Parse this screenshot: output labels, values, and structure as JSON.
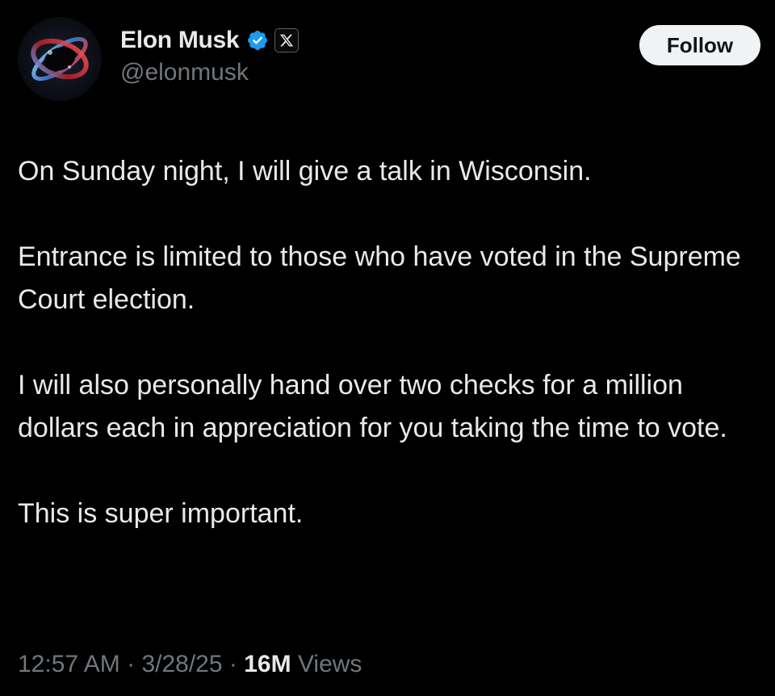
{
  "tweet": {
    "author": {
      "display_name": "Elon Musk",
      "handle": "@elonmusk",
      "verified_icon": "verified-badge-icon",
      "affiliate_icon": "x-logo-icon",
      "avatar": "avatar"
    },
    "follow_label": "Follow",
    "paragraphs": [
      "On Sunday night, I will give a talk in Wisconsin.",
      "Entrance is limited to those who have voted in the Supreme Court election.",
      "I will also personally hand over two checks for a million dollars each in appreciation for you taking the time to vote.",
      "This is super important."
    ],
    "meta": {
      "time": "12:57 AM",
      "date": "3/28/25",
      "separator": "·",
      "views_count": "16M",
      "views_label": "Views"
    }
  },
  "colors": {
    "background": "#000000",
    "text_primary": "#e7e9ea",
    "text_secondary": "#71767b",
    "verified_blue": "#1d9bf0",
    "follow_bg": "#eff3f4",
    "follow_text": "#0f1419"
  }
}
